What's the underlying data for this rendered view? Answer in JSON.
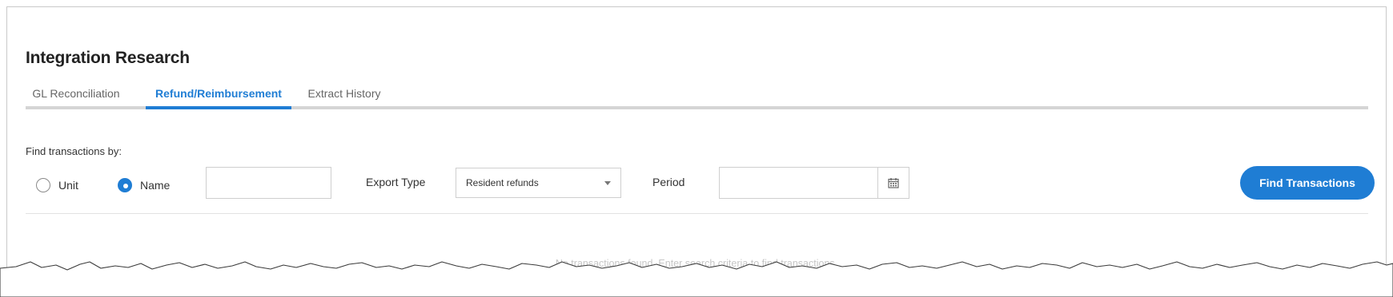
{
  "page": {
    "title": "Integration Research"
  },
  "tabs": [
    {
      "label": "GL Reconciliation",
      "active": false
    },
    {
      "label": "Refund/Reimbursement",
      "active": true
    },
    {
      "label": "Extract History",
      "active": false
    }
  ],
  "search": {
    "find_label": "Find transactions by:",
    "search_by": {
      "options": [
        {
          "label": "Unit",
          "checked": false
        },
        {
          "label": "Name",
          "checked": true
        }
      ]
    },
    "name_value": "",
    "export_type": {
      "label": "Export Type",
      "selected": "Resident refunds"
    },
    "period": {
      "label": "Period",
      "value": ""
    },
    "find_button_label": "Find Transactions"
  },
  "results": {
    "empty_message": "No transactions found. Enter search criteria to find transactions."
  },
  "icons": {
    "calendar": "calendar-icon",
    "dropdown": "caret-down-icon"
  },
  "colors": {
    "accent": "#1f7dd4",
    "tab_track": "#d5d5d5",
    "empty_text": "#c6c6c6"
  }
}
